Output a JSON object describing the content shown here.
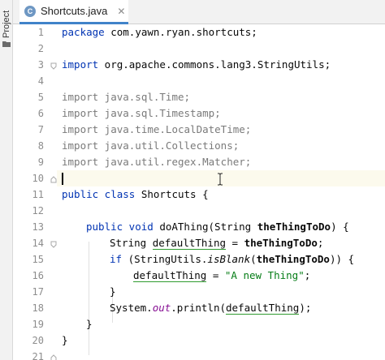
{
  "tool_window": {
    "label": "Project"
  },
  "tab": {
    "icon_letter": "C",
    "label": "Shortcuts.java",
    "close": "✕"
  },
  "line_numbers": [
    "1",
    "2",
    "3",
    "4",
    "5",
    "6",
    "7",
    "8",
    "9",
    "10",
    "11",
    "12",
    "13",
    "14",
    "15",
    "16",
    "17",
    "18",
    "19",
    "20",
    "21"
  ],
  "code": {
    "l1_kw": "package",
    "l1_rest": " com.yawn.ryan.shortcuts;",
    "l3_kw": "import",
    "l3_rest": " org.apache.commons.lang3.StringUtils;",
    "l5": "import java.sql.Time;",
    "l6": "import java.sql.Timestamp;",
    "l7": "import java.time.LocalDateTime;",
    "l8": "import java.util.Collections;",
    "l9": "import java.util.regex.Matcher;",
    "l11_kw": "public class",
    "l11_rest": " Shortcuts {",
    "l13_kw1": "public",
    "l13_kw2": " void",
    "l13_method": " doAThing",
    "l13_paren": "(String ",
    "l13_param": "theThingToDo",
    "l13_end": ") {",
    "l14_type": "String ",
    "l14_var": "defaultThing",
    "l14_eq": " = ",
    "l14_param": "theThingToDo",
    "l14_end": ";",
    "l15_kw": "if",
    "l15_open": " (StringUtils.",
    "l15_method": "isBlank",
    "l15_paren": "(",
    "l15_param": "theThingToDo",
    "l15_end": ")) {",
    "l16_var": "defaultThing",
    "l16_eq": " = ",
    "l16_str": "\"A new Thing\"",
    "l16_end": ";",
    "l17": "}",
    "l18_obj": "System.",
    "l18_field": "out",
    "l18_call": ".println(",
    "l18_var": "defaultThing",
    "l18_end": ");",
    "l19": "}",
    "l20": "}"
  }
}
